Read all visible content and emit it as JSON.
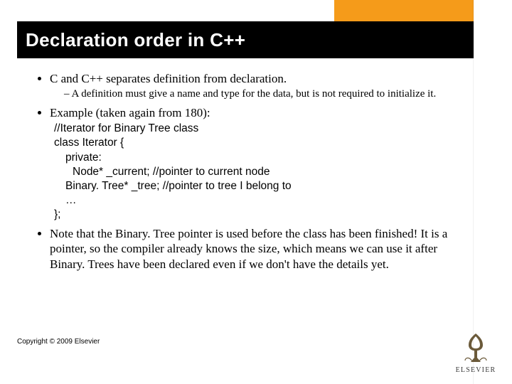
{
  "slide": {
    "title": "Declaration order in C++",
    "bullets": {
      "b1": "C and C++ separates definition from declaration.",
      "b1_sub": "A definition must give a name and type for the data, but is not required to initialize it.",
      "b2": "Example (taken again from 180):",
      "code": {
        "l1": "//Iterator for Binary Tree class",
        "l2": "class Iterator {",
        "l3": "private:",
        "l4": "Node* _current; //pointer to current node",
        "l5": "Binary. Tree* _tree; //pointer to tree I belong to",
        "l6": "…",
        "l7": "};"
      },
      "b3": "Note that the Binary. Tree pointer is used before the class has been finished! It is a pointer, so the compiler already knows the size, which means we can use it after Binary. Trees have been declared even if we don't have the details yet."
    },
    "copyright": "Copyright © 2009 Elsevier",
    "logo_label": "ELSEVIER"
  }
}
